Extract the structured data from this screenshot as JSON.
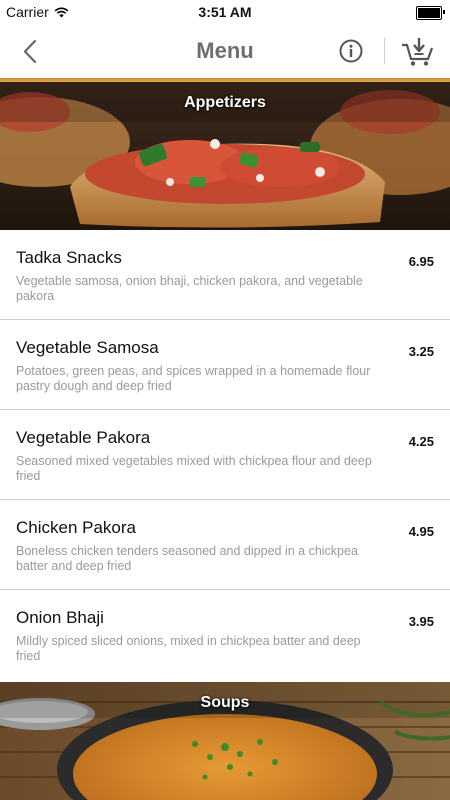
{
  "status_bar": {
    "carrier": "Carrier",
    "time": "3:51 AM",
    "wifi_icon": "wifi-icon",
    "battery_icon": "battery-icon"
  },
  "nav": {
    "title": "Menu",
    "back_icon": "chevron-left-icon",
    "info_icon": "info-icon",
    "cart_icon": "cart-icon",
    "accent_color": "#d4952f"
  },
  "sections": [
    {
      "title": "Appetizers",
      "items": [
        {
          "name": "Tadka Snacks",
          "description": "Vegetable samosa, onion bhaji, chicken pakora, and vegetable pakora",
          "price": "6.95"
        },
        {
          "name": "Vegetable Samosa",
          "description": "Potatoes, green peas, and spices wrapped in a homemade flour pastry dough and deep fried",
          "price": "3.25"
        },
        {
          "name": "Vegetable Pakora",
          "description": "Seasoned mixed vegetables mixed with chickpea flour and deep fried",
          "price": "4.25"
        },
        {
          "name": "Chicken Pakora",
          "description": "Boneless chicken tenders seasoned and dipped in a chickpea batter and deep fried",
          "price": "4.95"
        },
        {
          "name": "Onion Bhaji",
          "description": "Mildly spiced sliced onions, mixed in chickpea batter and deep fried",
          "price": "3.95"
        }
      ]
    },
    {
      "title": "Soups",
      "items": []
    }
  ]
}
